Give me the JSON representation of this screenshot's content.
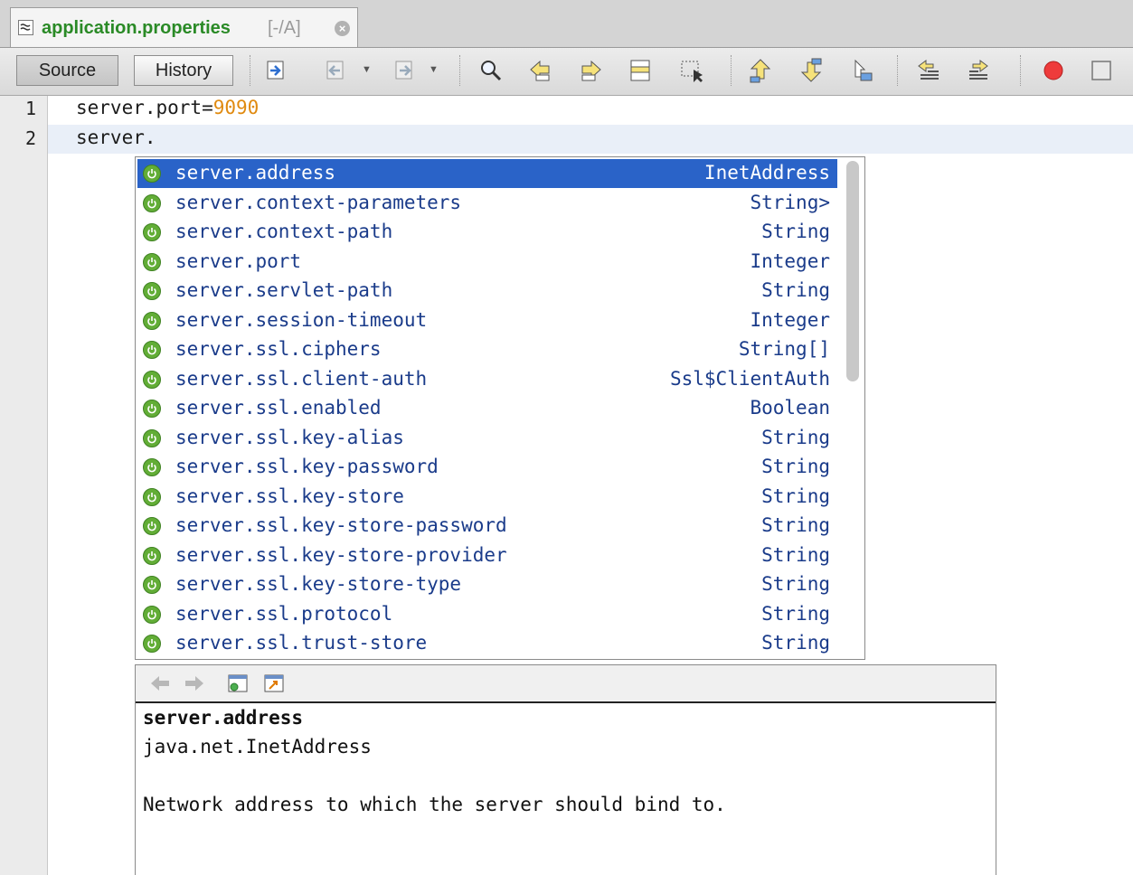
{
  "tab": {
    "file_icon": "properties-file-icon",
    "title": "application.properties",
    "path": "[-/A]",
    "close_icon": "close-icon"
  },
  "toolbar": {
    "source_label": "Source",
    "history_label": "History",
    "icons": [
      "last-edit-icon",
      "back-icon",
      "forward-icon",
      "find-icon",
      "find-previous-icon",
      "find-next-icon",
      "toggle-highlight-icon",
      "find-selection-icon",
      "previous-bookmark-icon",
      "next-bookmark-icon",
      "toggle-bookmark-icon",
      "shift-left-icon",
      "shift-right-icon",
      "start-macro-icon",
      "stop-macro-icon"
    ]
  },
  "editor": {
    "lines": [
      {
        "number": "1",
        "key": "server.port=",
        "value": "9090"
      },
      {
        "number": "2",
        "key": "server.",
        "value": ""
      }
    ]
  },
  "completion": {
    "item_icon": "spring-boot-icon",
    "selected_index": 0,
    "items": [
      {
        "name": "server.address",
        "type": "InetAddress"
      },
      {
        "name": "server.context-parameters",
        "type": "String>"
      },
      {
        "name": "server.context-path",
        "type": "String"
      },
      {
        "name": "server.port",
        "type": "Integer"
      },
      {
        "name": "server.servlet-path",
        "type": "String"
      },
      {
        "name": "server.session-timeout",
        "type": "Integer"
      },
      {
        "name": "server.ssl.ciphers",
        "type": "String[]"
      },
      {
        "name": "server.ssl.client-auth",
        "type": "Ssl$ClientAuth"
      },
      {
        "name": "server.ssl.enabled",
        "type": "Boolean"
      },
      {
        "name": "server.ssl.key-alias",
        "type": "String"
      },
      {
        "name": "server.ssl.key-password",
        "type": "String"
      },
      {
        "name": "server.ssl.key-store",
        "type": "String"
      },
      {
        "name": "server.ssl.key-store-password",
        "type": "String"
      },
      {
        "name": "server.ssl.key-store-provider",
        "type": "String"
      },
      {
        "name": "server.ssl.key-store-type",
        "type": "String"
      },
      {
        "name": "server.ssl.protocol",
        "type": "String"
      },
      {
        "name": "server.ssl.trust-store",
        "type": "String"
      }
    ]
  },
  "documentation": {
    "toolbar_icons": [
      "doc-back-icon",
      "doc-forward-icon",
      "open-in-browser-icon",
      "goto-source-icon"
    ],
    "title": "server.address",
    "type": "java.net.InetAddress",
    "description": "Network address to which the server should bind to."
  },
  "colors": {
    "tab_title": "#2a8a26",
    "selection": "#2a63c8",
    "completion_text": "#1a3b8a",
    "number_literal": "#e08a10",
    "spring_icon": "#62ad36"
  }
}
